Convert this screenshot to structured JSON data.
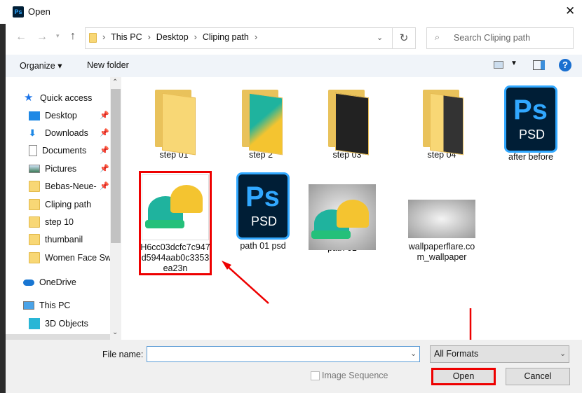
{
  "window": {
    "title": "Open",
    "app_icon": "Ps"
  },
  "address": {
    "crumbs": [
      "This PC",
      "Desktop",
      "Cliping path"
    ]
  },
  "search": {
    "placeholder": "Search Cliping path"
  },
  "toolbar": {
    "organize": "Organize ▾",
    "new_folder": "New folder",
    "help": "?"
  },
  "sidebar": {
    "items": [
      {
        "label": "Quick access",
        "pinned": false
      },
      {
        "label": "Desktop",
        "pinned": true
      },
      {
        "label": "Downloads",
        "pinned": true
      },
      {
        "label": "Documents",
        "pinned": true
      },
      {
        "label": "Pictures",
        "pinned": true
      },
      {
        "label": "Bebas-Neue-",
        "pinned": true
      },
      {
        "label": "Cliping path",
        "pinned": false
      },
      {
        "label": "step 10",
        "pinned": false
      },
      {
        "label": "thumbanil",
        "pinned": false
      },
      {
        "label": "Women Face Sw",
        "pinned": false
      },
      {
        "label": "OneDrive",
        "pinned": false
      },
      {
        "label": "This PC",
        "pinned": false
      },
      {
        "label": "3D Objects",
        "pinned": false
      }
    ]
  },
  "files": [
    {
      "name": "step 01",
      "type": "folder"
    },
    {
      "name": "step 2",
      "type": "folder"
    },
    {
      "name": "step 03",
      "type": "folder"
    },
    {
      "name": "step 04",
      "type": "folder"
    },
    {
      "name": "after before",
      "type": "psd"
    },
    {
      "name": "H6cc03dcfc7c947d5944aab0c3353ea23n",
      "type": "image",
      "selected_highlight": true
    },
    {
      "name": "path 01 psd",
      "type": "psd"
    },
    {
      "name": "path 01",
      "type": "image"
    },
    {
      "name": "wallpaperflare.com_wallpaper",
      "type": "image"
    }
  ],
  "psd": {
    "ps": "Ps",
    "ext": "PSD"
  },
  "footer": {
    "file_name_label": "File name:",
    "file_name_value": "",
    "format": "All Formats",
    "image_sequence": "Image Sequence",
    "open": "Open",
    "cancel": "Cancel"
  },
  "colors": {
    "annotation": "#e00000",
    "accent": "#1a6fd0"
  }
}
